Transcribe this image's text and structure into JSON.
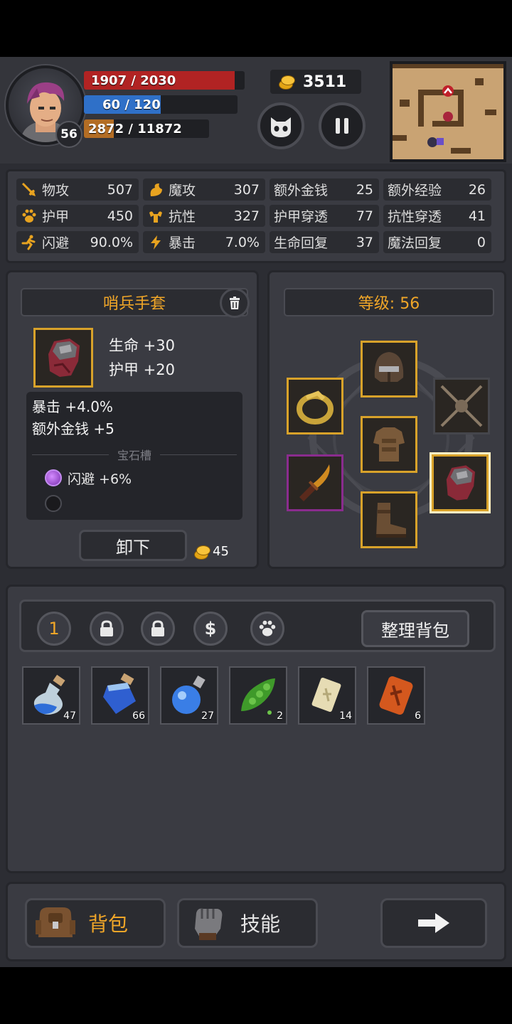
{
  "hud": {
    "portrait_level": "56",
    "hp_text": "1907 / 2030",
    "hp_fraction": 0.94,
    "mp_text": "60 / 120",
    "mp_fraction": 0.5,
    "xp_text": "2872 / 11872",
    "xp_fraction": 0.24,
    "gold": "3511"
  },
  "stats": [
    {
      "icon": "sword-icon",
      "label": "物攻",
      "value": "507"
    },
    {
      "icon": "magic-icon",
      "label": "魔攻",
      "value": "307"
    },
    {
      "icon": "",
      "label": "额外金钱",
      "value": "25"
    },
    {
      "icon": "",
      "label": "额外经验",
      "value": "26"
    },
    {
      "icon": "paw-icon",
      "label": "护甲",
      "value": "450"
    },
    {
      "icon": "muscle-icon",
      "label": "抗性",
      "value": "327"
    },
    {
      "icon": "",
      "label": "护甲穿透",
      "value": "77"
    },
    {
      "icon": "",
      "label": "抗性穿透",
      "value": "41"
    },
    {
      "icon": "running-icon",
      "label": "闪避",
      "value": "90.0%"
    },
    {
      "icon": "lightning-icon",
      "label": "暴击",
      "value": "7.0%"
    },
    {
      "icon": "",
      "label": "生命回复",
      "value": "37"
    },
    {
      "icon": "",
      "label": "魔法回复",
      "value": "0"
    }
  ],
  "item": {
    "name": "哨兵手套",
    "base_stats": [
      "生命 +30",
      "护甲 +20"
    ],
    "affixes": [
      "暴击 +4.0%",
      "额外金钱 +5"
    ],
    "gem_slot_title": "宝石槽",
    "gem_1": "闪避 +6%",
    "unequip_label": "卸下",
    "sell_price": "45"
  },
  "equip": {
    "level_label": "等级: 56"
  },
  "bag": {
    "tab_1_label": "1",
    "tab_money_label": "$",
    "sort_label": "整理背包",
    "items": [
      {
        "icon": "potion-bottle-icon",
        "count": "47"
      },
      {
        "icon": "mana-jar-icon",
        "count": "66"
      },
      {
        "icon": "mana-flask-icon",
        "count": "27"
      },
      {
        "icon": "pea-pod-icon",
        "count": "2"
      },
      {
        "icon": "rune-scroll-icon",
        "count": "14"
      },
      {
        "icon": "fire-rune-icon",
        "count": "6"
      }
    ]
  },
  "nav": {
    "bag_label": "背包",
    "skill_label": "技能"
  },
  "colors": {
    "accent": "#f0a628",
    "hp": "#b12323",
    "mp": "#2f70c8",
    "xp": "#b36d24",
    "panel": "#3a3b42"
  }
}
